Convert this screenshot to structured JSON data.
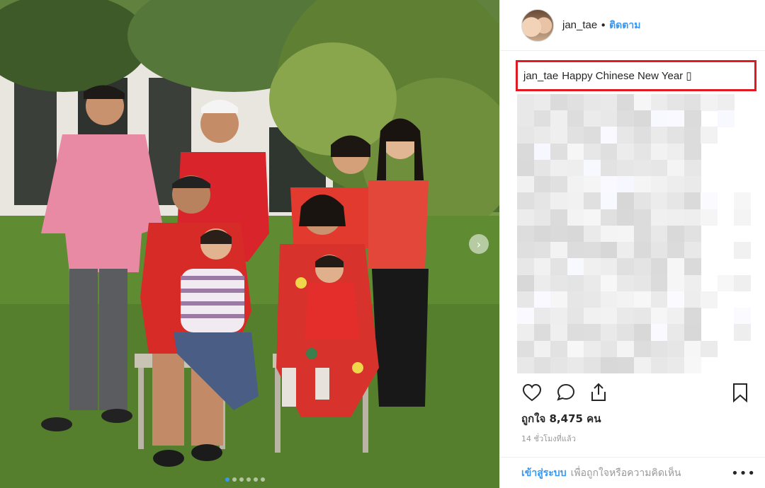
{
  "post": {
    "username": "jan_tae",
    "separator": "•",
    "follow_label": "ติดตาม",
    "caption_user": "jan_tae",
    "caption_text": "Happy Chinese New Year ▯",
    "likes_text": "ถูกใจ 8,475 คน",
    "time_text": "14 ชั่วโมงที่แล้ว",
    "login_label": "เข้าสู่ระบบ",
    "login_hint": "เพื่อถูกใจหรือความคิดเห็น",
    "more_label": "•••",
    "carousel": {
      "total": 6,
      "active_index": 0
    },
    "next_icon": "chevron-right-icon"
  },
  "colors": {
    "link": "#3897f0",
    "highlight_border": "#e01a22",
    "text": "#262626",
    "muted": "#999999"
  }
}
